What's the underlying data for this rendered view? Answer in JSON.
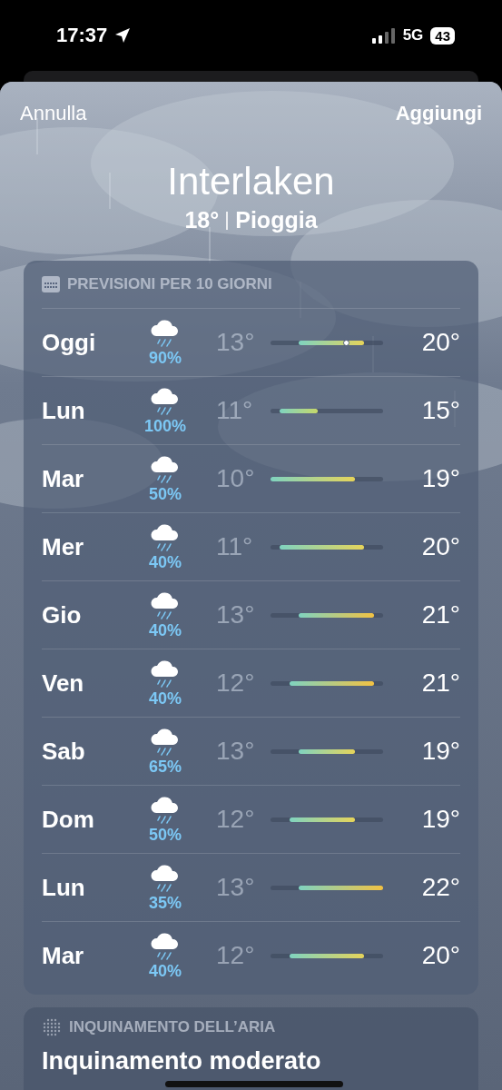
{
  "status_bar": {
    "time": "17:37",
    "network": "5G",
    "battery": "43"
  },
  "nav": {
    "cancel": "Annulla",
    "add": "Aggiungi"
  },
  "location": {
    "city": "Interlaken",
    "temperature": "18°",
    "condition": "Pioggia"
  },
  "forecast": {
    "title": "PREVISIONI PER 10 GIORNI",
    "days": [
      {
        "day": "Oggi",
        "chance": "90%",
        "low": "13°",
        "high": "20°",
        "current": true
      },
      {
        "day": "Lun",
        "chance": "100%",
        "low": "11°",
        "high": "15°",
        "current": false
      },
      {
        "day": "Mar",
        "chance": "50%",
        "low": "10°",
        "high": "19°",
        "current": false
      },
      {
        "day": "Mer",
        "chance": "40%",
        "low": "11°",
        "high": "20°",
        "current": false
      },
      {
        "day": "Gio",
        "chance": "40%",
        "low": "13°",
        "high": "21°",
        "current": false
      },
      {
        "day": "Ven",
        "chance": "40%",
        "low": "12°",
        "high": "21°",
        "current": false
      },
      {
        "day": "Sab",
        "chance": "65%",
        "low": "13°",
        "high": "19°",
        "current": false
      },
      {
        "day": "Dom",
        "chance": "50%",
        "low": "12°",
        "high": "19°",
        "current": false
      },
      {
        "day": "Lun",
        "chance": "35%",
        "low": "13°",
        "high": "22°",
        "current": false
      },
      {
        "day": "Mar",
        "chance": "40%",
        "low": "12°",
        "high": "20°",
        "current": false
      }
    ]
  },
  "air_quality": {
    "title": "INQUINAMENTO DELL’ARIA",
    "summary": "Inquinamento moderato"
  }
}
